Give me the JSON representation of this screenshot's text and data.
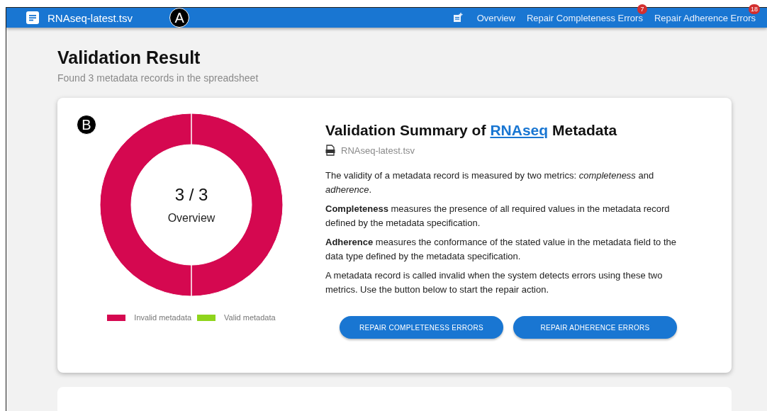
{
  "header": {
    "title": "RNAseq-latest.tsv",
    "marker": "A",
    "nav": [
      {
        "label": "Overview"
      },
      {
        "label": "Repair Completeness Errors",
        "badge": "7"
      },
      {
        "label": "Repair Adherence Errors",
        "badge": "18"
      }
    ]
  },
  "page": {
    "title": "Validation Result",
    "subtitle": "Found 3 metadata records in the spreadsheet"
  },
  "summary": {
    "marker": "B",
    "center_value": "3 / 3",
    "center_label": "Overview",
    "chart_data": {
      "type": "pie",
      "categories": [
        "Invalid metadata",
        "Valid metadata"
      ],
      "values": [
        100,
        0
      ],
      "colors": [
        "#d50850",
        "#8fd41c"
      ]
    },
    "title_prefix": "Validation Summary of",
    "title_link": "RNAseq",
    "title_suffix": "Metadata",
    "file": "RNAseq-latest.tsv",
    "paragraphs": [
      "The validity of a metadata record is measured by two metrics: *completeness* and *adherence*.",
      "**Completeness** measures the presence of all required values in the metadata record defined by the metadata specification.",
      "**Adherence** measures the conformance of the stated value in the metadata field to the data type defined by the metadata specification.",
      "A metadata record is called invalid when the system detects errors using these two metrics. Use the button below to start the repair action."
    ],
    "buttons": [
      "REPAIR COMPLETENESS ERRORS",
      "REPAIR ADHERENCE ERRORS"
    ]
  }
}
